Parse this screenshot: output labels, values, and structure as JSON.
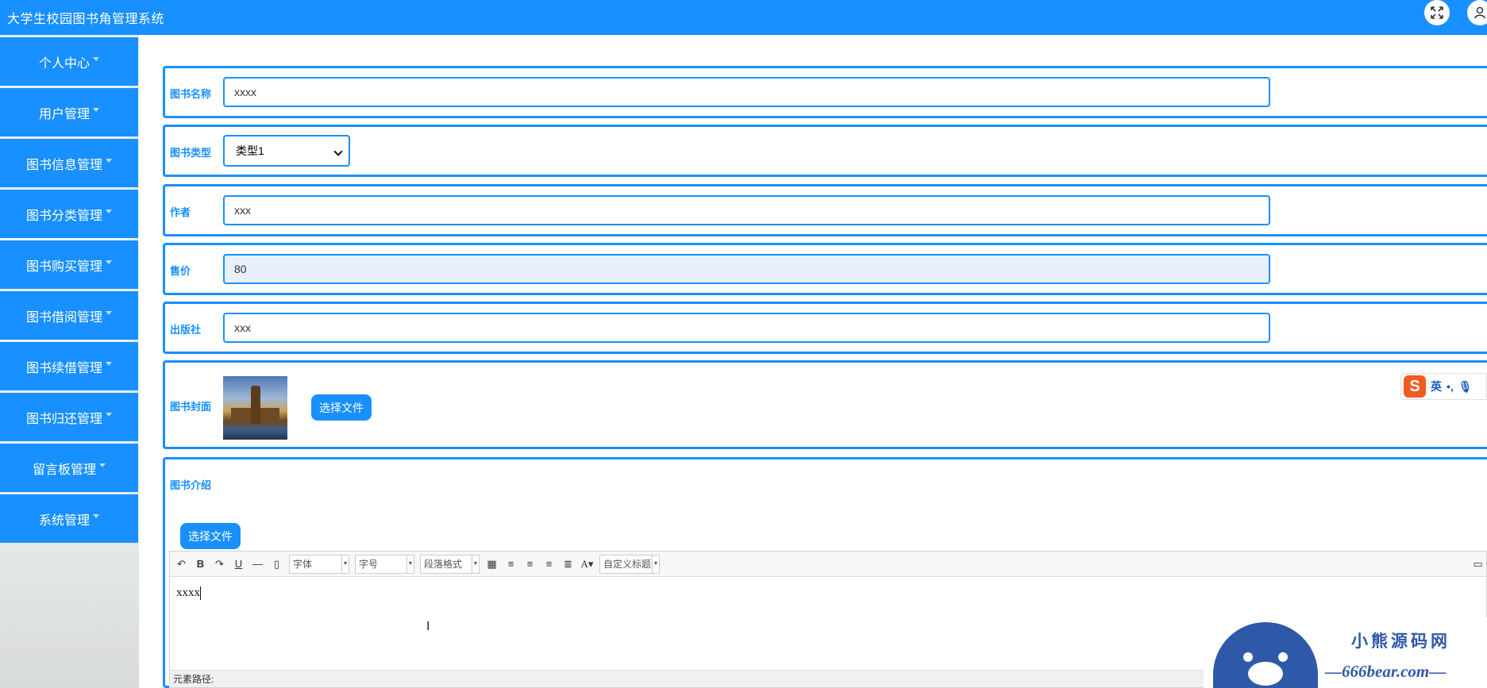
{
  "header": {
    "title": "大学生校园图书角管理系统",
    "expand_icon": "expand-icon",
    "user_icon": "user-icon"
  },
  "sidebar": {
    "items": [
      {
        "label": "个人中心"
      },
      {
        "label": "用户管理"
      },
      {
        "label": "图书信息管理"
      },
      {
        "label": "图书分类管理"
      },
      {
        "label": "图书购买管理"
      },
      {
        "label": "图书借阅管理"
      },
      {
        "label": "图书续借管理"
      },
      {
        "label": "图书归还管理"
      },
      {
        "label": "留言板管理"
      },
      {
        "label": "系统管理"
      }
    ]
  },
  "form": {
    "book_name": {
      "label": "图书名称",
      "value": "xxxx"
    },
    "book_type": {
      "label": "图书类型",
      "value": "类型1"
    },
    "author": {
      "label": "作者",
      "value": "xxx"
    },
    "price": {
      "label": "售价",
      "value": "80"
    },
    "publisher": {
      "label": "出版社",
      "value": "xxx"
    },
    "cover": {
      "label": "图书封面",
      "button": "选择文件"
    },
    "intro": {
      "label": "图书介绍",
      "button": "选择文件"
    }
  },
  "editor": {
    "toolbar": {
      "font_family": "字体",
      "font_size": "字号",
      "paragraph": "段落格式",
      "custom_title": "自定义标题"
    },
    "content": "xxxx",
    "status_label": "元素路径:"
  },
  "ime": {
    "lang": "英",
    "punct": "•,"
  },
  "watermark": {
    "brand": "小熊源码网",
    "url": "—666bear.com—"
  },
  "colors": {
    "primary": "#1890ff",
    "white": "#ffffff",
    "brand_blue": "#2e59a8",
    "ime_orange": "#f15a22"
  }
}
